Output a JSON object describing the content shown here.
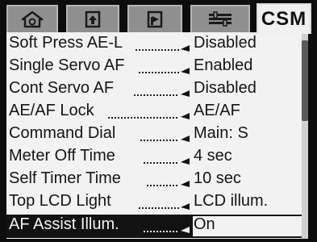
{
  "tabs": [
    {
      "name": "playback-menu",
      "icon": "playback-icon"
    },
    {
      "name": "shooting-menu",
      "icon": "camera-icon"
    },
    {
      "name": "setup-menu",
      "icon": "setup-icon"
    },
    {
      "name": "custom-settings-menu",
      "icon": "wrench-icon"
    },
    {
      "name": "csm",
      "label": "CSM"
    }
  ],
  "menu": {
    "rows": [
      {
        "label": "Soft Press AE-L",
        "value": "Disabled"
      },
      {
        "label": "Single Servo AF",
        "value": "Enabled"
      },
      {
        "label": "Cont Servo AF",
        "value": "Disabled"
      },
      {
        "label": "AE/AF Lock",
        "value": "AE/AF"
      },
      {
        "label": "Command Dial",
        "value": "Main: S"
      },
      {
        "label": "Meter Off Time",
        "value": "4 sec"
      },
      {
        "label": "Self Timer Time",
        "value": "10 sec"
      },
      {
        "label": "Top LCD Light",
        "value": "LCD illum."
      },
      {
        "label": "AF Assist Illum.",
        "value": "On"
      }
    ],
    "selected_index": 8
  },
  "scrollbar": {
    "position_fraction": 0.0
  },
  "colors": {
    "background": "#0d0d0d",
    "panel": "#f2f2f2",
    "tab_inactive": "#8f8f8f",
    "tab_active": "#f0f0f0",
    "selected_row": "#121212"
  }
}
